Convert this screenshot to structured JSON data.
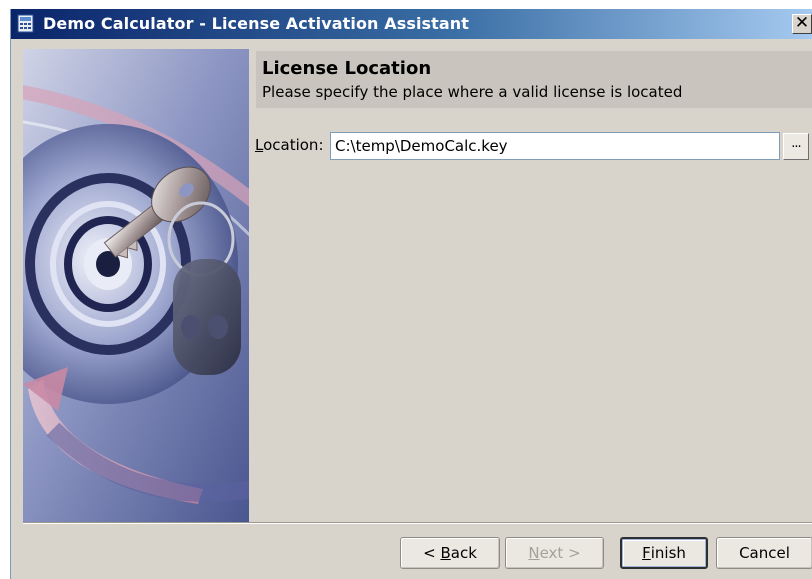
{
  "window": {
    "title": "Demo Calculator - License Activation Assistant",
    "close_glyph": "✕"
  },
  "header": {
    "title": "License Location",
    "subtitle": "Please specify the place where a valid license is located"
  },
  "location": {
    "label_mnemonic": "L",
    "label_rest": "ocation:",
    "value": "C:\\temp\\DemoCalc.key",
    "browse_label": "..."
  },
  "buttons": {
    "back_prefix": "< ",
    "back_mnemonic": "B",
    "back_rest": "ack",
    "next_mnemonic": "N",
    "next_rest": "ext >",
    "finish_mnemonic": "F",
    "finish_rest": "inish",
    "cancel": "Cancel"
  },
  "colors": {
    "title_bar_start": "#0a246a",
    "dialog_bg": "#d8d4cc",
    "header_bg": "#c9c5be"
  },
  "icons": [
    "app-icon",
    "close-icon",
    "key-cd-illustration"
  ]
}
